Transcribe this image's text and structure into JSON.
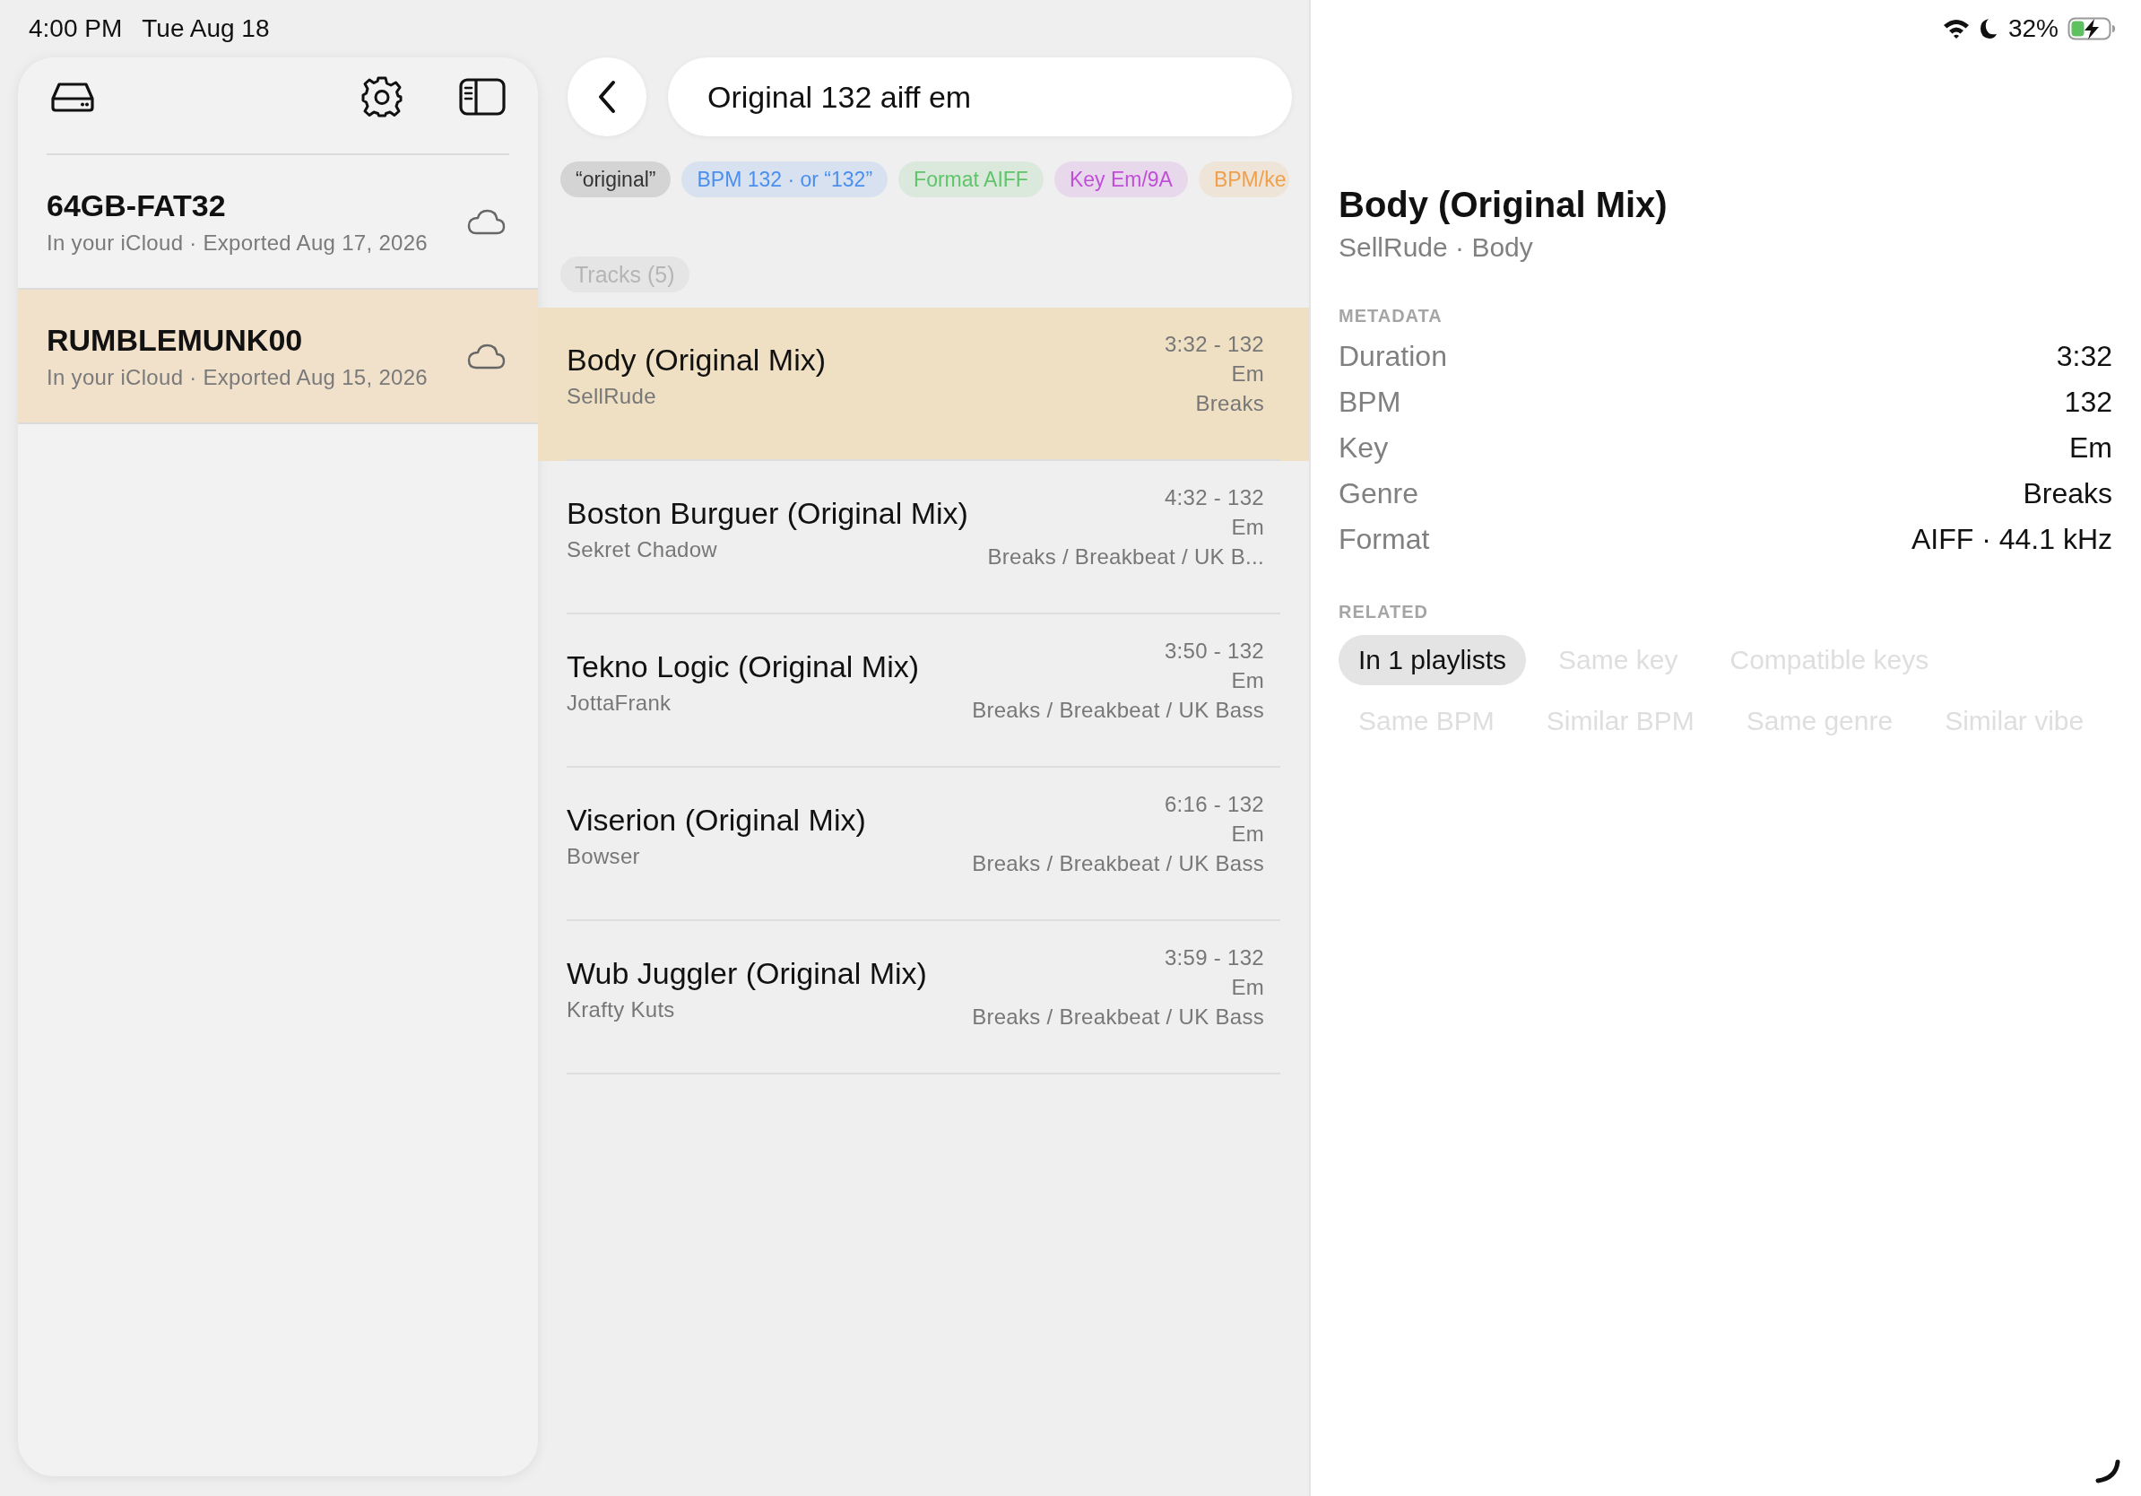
{
  "status_bar": {
    "time": "4:00 PM",
    "date": "Tue Aug 18",
    "battery": "32%"
  },
  "sidebar": {
    "items": [
      {
        "title": "64GB-FAT32",
        "subtitle": "In your iCloud · Exported Aug 17, 2026",
        "selected": false
      },
      {
        "title": "RUMBLEMUNK00",
        "subtitle": "In your iCloud · Exported Aug 15, 2026",
        "selected": true
      }
    ]
  },
  "search": {
    "value": "Original 132 aiff em"
  },
  "filter_chips": [
    {
      "label": "“original”",
      "color": "#333333"
    },
    {
      "label": "BPM 132 · or “132”",
      "color": "#4a8ff0"
    },
    {
      "label": "Format AIFF",
      "color": "#5fc46a"
    },
    {
      "label": "Key Em/9A",
      "color": "#c04fd8"
    },
    {
      "label": "BPM/ke",
      "color": "#f0a04b"
    }
  ],
  "tracks_heading": "Tracks (5)",
  "tracks": [
    {
      "title": "Body (Original Mix)",
      "artist": "SellRude",
      "time_bpm": "3:32 - 132",
      "key": "Em",
      "genre": "Breaks",
      "selected": true
    },
    {
      "title": "Boston Burguer (Original Mix)",
      "artist": "Sekret Chadow",
      "time_bpm": "4:32 - 132",
      "key": "Em",
      "genre": "Breaks / Breakbeat / UK B...",
      "selected": false
    },
    {
      "title": "Tekno Logic (Original Mix)",
      "artist": "JottaFrank",
      "time_bpm": "3:50 - 132",
      "key": "Em",
      "genre": "Breaks / Breakbeat / UK Bass",
      "selected": false
    },
    {
      "title": "Viserion (Original Mix)",
      "artist": "Bowser",
      "time_bpm": "6:16 - 132",
      "key": "Em",
      "genre": "Breaks / Breakbeat / UK Bass",
      "selected": false
    },
    {
      "title": "Wub Juggler (Original Mix)",
      "artist": "Krafty Kuts",
      "time_bpm": "3:59 - 132",
      "key": "Em",
      "genre": "Breaks / Breakbeat / UK Bass",
      "selected": false
    }
  ],
  "detail": {
    "title": "Body (Original Mix)",
    "subtitle": "SellRude · Body",
    "metadata_heading": "METADATA",
    "metadata": [
      {
        "label": "Duration",
        "value": "3:32"
      },
      {
        "label": "BPM",
        "value": "132"
      },
      {
        "label": "Key",
        "value": "Em"
      },
      {
        "label": "Genre",
        "value": "Breaks"
      },
      {
        "label": "Format",
        "value": "AIFF · 44.1 kHz"
      }
    ],
    "related_heading": "RELATED",
    "related": [
      [
        {
          "label": "In 1 playlists",
          "selected": true,
          "disabled": false
        },
        {
          "label": "Same key",
          "selected": false,
          "disabled": true
        },
        {
          "label": "Compatible keys",
          "selected": false,
          "disabled": true
        }
      ],
      [
        {
          "label": "Same BPM",
          "selected": false,
          "disabled": true
        },
        {
          "label": "Similar BPM",
          "selected": false,
          "disabled": true
        },
        {
          "label": "Same genre",
          "selected": false,
          "disabled": true
        },
        {
          "label": "Similar vibe",
          "selected": false,
          "disabled": true
        }
      ]
    ]
  }
}
